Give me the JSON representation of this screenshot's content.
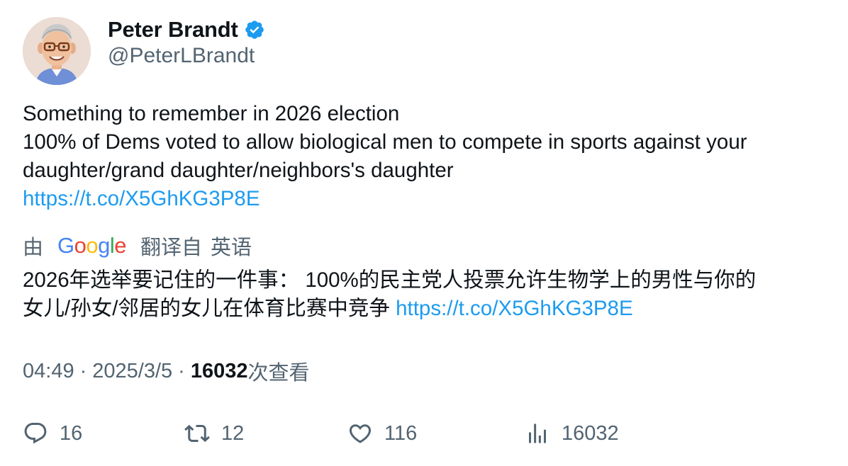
{
  "author": {
    "display_name": "Peter Brandt",
    "handle": "@PeterLBrandt",
    "verified": true
  },
  "tweet": {
    "lines": [
      "Something to remember in 2026 election",
      "100% of Dems voted to allow biological men to compete in sports against your",
      "daughter/grand daughter/neighbors's daughter"
    ],
    "link": "https://t.co/X5GhKG3P8E"
  },
  "translation": {
    "by_label": "由",
    "provider": "Google",
    "from_label": "翻译自",
    "source_language": "英语",
    "lines": [
      "2026年选举要记住的一件事： 100%的民主党人投票允许生物学上的男性与你的",
      "女儿/孙女/邻居的女儿在体育比赛中竞争"
    ],
    "link": "https://t.co/X5GhKG3P8E"
  },
  "meta": {
    "time": "04:49",
    "separator": "·",
    "date": "2025/3/5",
    "views_count": "16032",
    "views_label": "次查看"
  },
  "actions": {
    "reply_count": "16",
    "retweet_count": "12",
    "like_count": "116",
    "views_count": "16032"
  },
  "colors": {
    "link": "#1d9bf0",
    "secondary_text": "#536471",
    "primary_text": "#0f1419",
    "verified_badge": "#1d9bf0",
    "google_blue": "#4285F4",
    "google_red": "#EA4335",
    "google_yellow": "#FBBC05",
    "google_green": "#34A853"
  },
  "icons": {
    "verified": "verified-badge-icon",
    "reply": "reply-icon",
    "retweet": "retweet-icon",
    "like": "heart-icon",
    "views": "bar-chart-icon"
  }
}
